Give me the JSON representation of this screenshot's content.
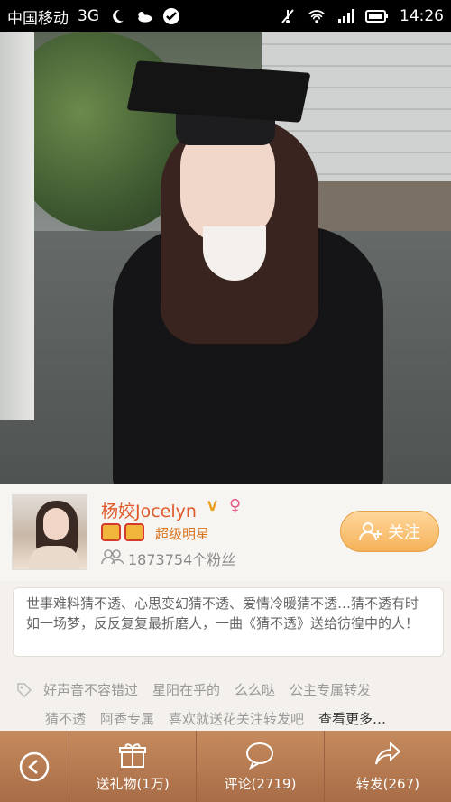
{
  "status_bar": {
    "carrier": "中国移动",
    "network": "3G",
    "time": "14:26"
  },
  "profile": {
    "name": "杨姣Jocelyn",
    "verified_badge": "V",
    "gender_symbol": "♀",
    "rank": "超级明星",
    "fans": "1873754个粉丝",
    "follow_label": "关注"
  },
  "bio": "世事难料猜不透、心思变幻猜不透、爱情冷暖猜不透…猜不透有时如一场梦，反反复复最折磨人，一曲《猜不透》送给彷徨中的人！",
  "tags": {
    "row1": [
      "好声音不容错过",
      "星阳在乎的",
      "么么哒",
      "公主专属转发"
    ],
    "row2": [
      "猜不透",
      "阿香专属",
      "喜欢就送花关注转发吧"
    ],
    "more": "查看更多…"
  },
  "bottom_bar": {
    "gift": "送礼物(1万)",
    "comment": "评论(2719)",
    "share": "转发(267)"
  },
  "colors": {
    "name": "#e05a2b",
    "follow_button": "#f5b25a",
    "bottom_bar": "#b57a52"
  }
}
